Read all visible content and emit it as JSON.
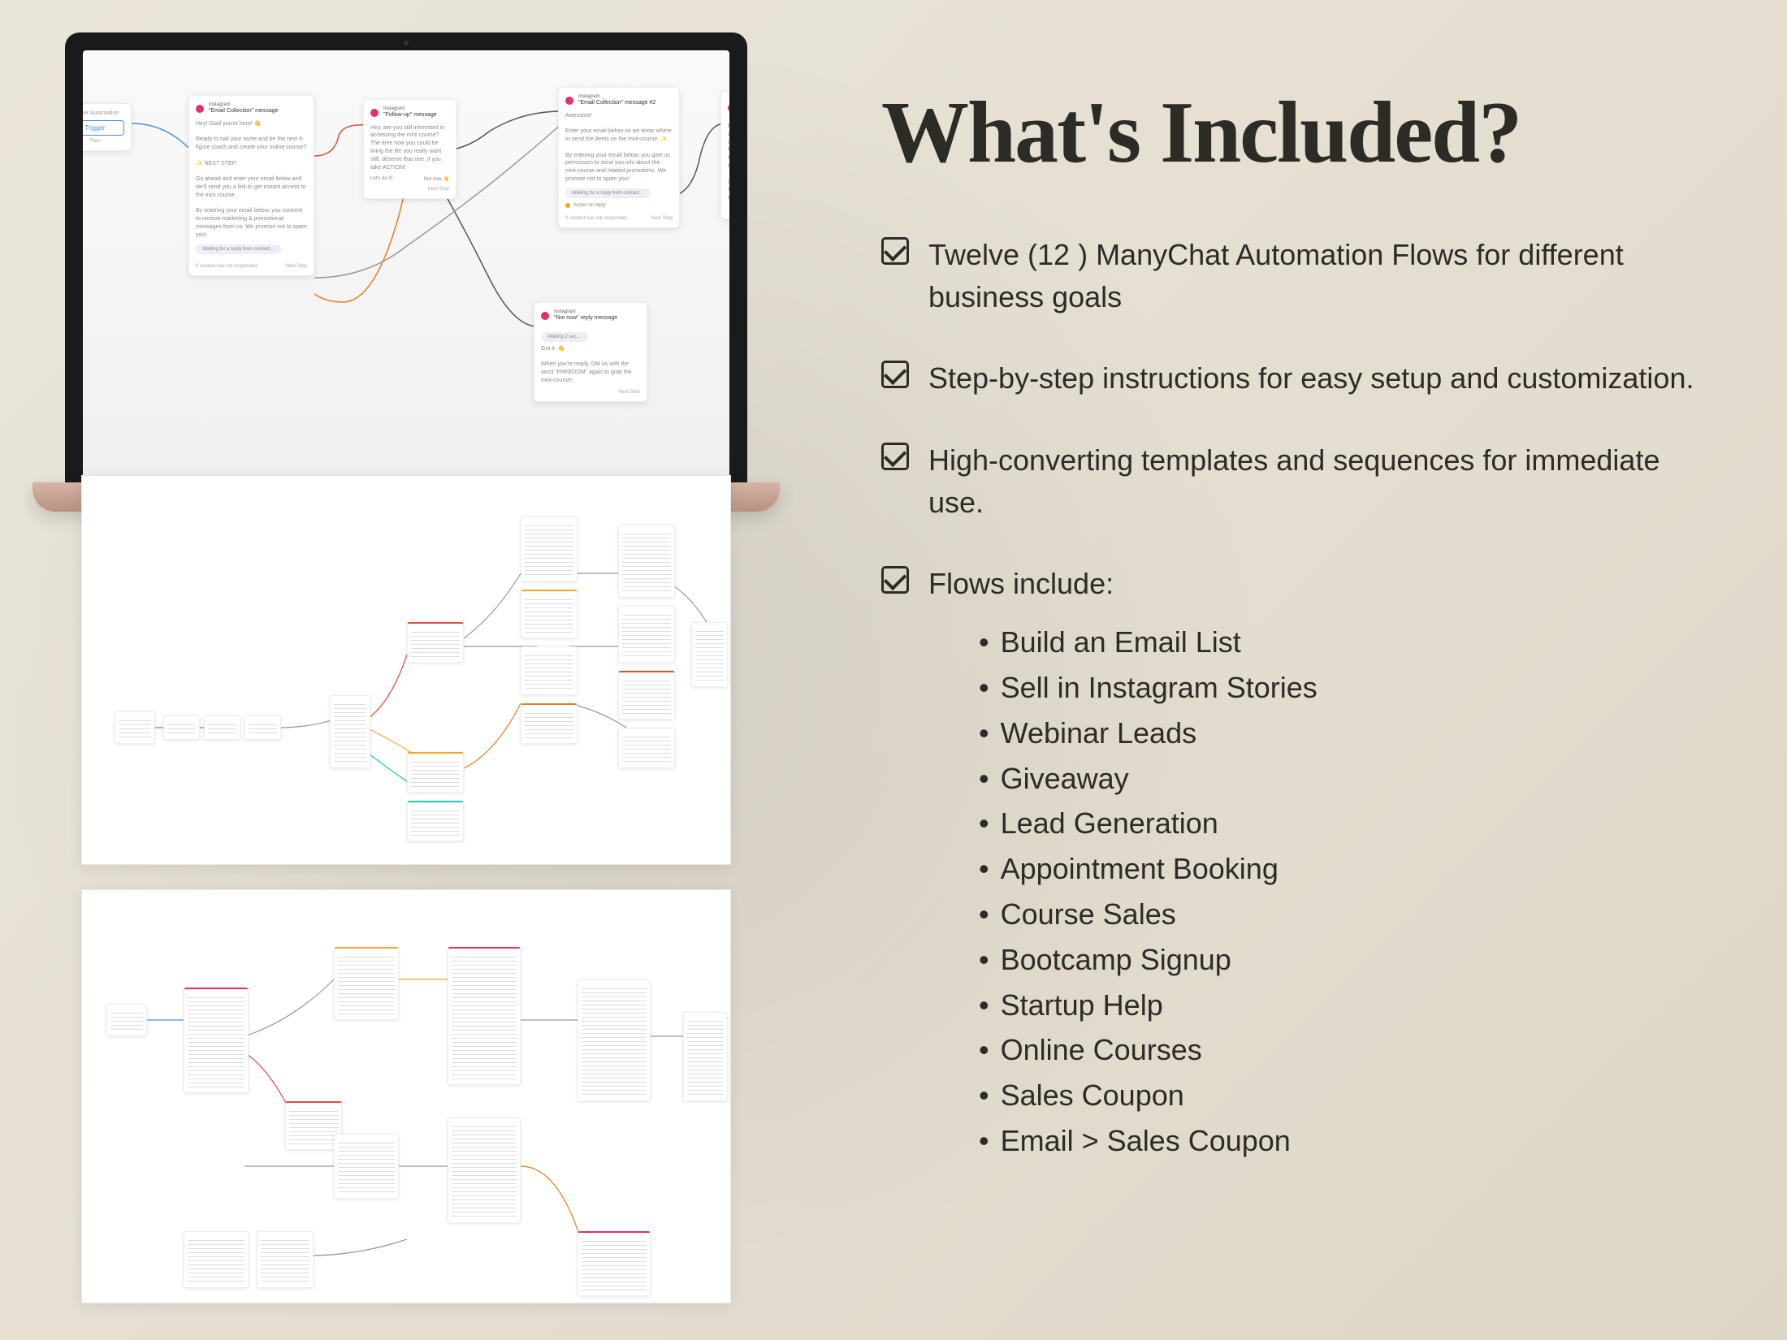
{
  "heading": "What's Included?",
  "features": [
    {
      "text": "Twelve (12 ) ManyChat Automation Flows for different business goals"
    },
    {
      "text": "Step-by-step instructions for easy setup and customization."
    },
    {
      "text": "High-converting templates and sequences for immediate use."
    },
    {
      "text": "Flows include:"
    }
  ],
  "flows": [
    "Build an Email List",
    "Sell in Instagram Stories",
    "Webinar Leads",
    "Giveaway",
    "Lead Generation",
    "Appointment Booking",
    "Course Sales",
    "Bootcamp Signup",
    "Startup Help",
    "Online Courses",
    "Sales Coupon",
    "Email > Sales Coupon"
  ],
  "laptop_nodes": {
    "trigger": {
      "label": "Trigger",
      "subtitle": "new user Automation"
    },
    "n1": {
      "tag": "Instagram",
      "title": "\"Email Collection\" message",
      "body": "Hey! Glad you're here! 👋\n\nReady to nail your niche and be the next 6-figure coach and create your online course?\n\n✨ NEXT STEP:\n\nGo ahead and enter your email below and we'll send you a link to get instant access to the mini course.\n\nBy entering your email below, you consent to receive marketing & promotional messages from us. We promise not to spam you!",
      "chip": "Waiting for a reply from contact…",
      "footer_left": "If contact has not responded",
      "footer_right": "Next Step"
    },
    "n2": {
      "tag": "Instagram",
      "title": "\"Follow-up\" message",
      "body": "Hey, are you still interested in accessing the mini course? The time now you could be living the life you really want still; deserve that one, if you take ACTION!",
      "left": "Let's do it!",
      "right": "Not now 👋",
      "footer": "Next Step"
    },
    "n3": {
      "tag": "Instagram",
      "title": "\"Email Collection\" message #2",
      "body": "Awesome!\n\nEnter your email below so we know where to send the deets on the mini-course. ✨\n\nBy entering your email below, you give us permission to send you info about the mini-course and related promotions. We promise not to spam you!",
      "chip": "Waiting for a reply from contact…",
      "action": "Action on reply",
      "footer_left": "If contact has not responded",
      "footer_right": "Next Step"
    },
    "n4": {
      "tag": "Instagram",
      "title": "\"Not now\" reply message",
      "body": "Got it. 👋\n\nWhen you're ready, DM us with the word \"FREEDOM\" again to grab the mini-course!",
      "chip": "Waiting 2 sec…",
      "footer": "Next Step"
    },
    "n5": {
      "tag": "Instagram",
      "title": "\"Email confirm…",
      "body": "Perfect! You can al… over for a notice f… bonus for the most… the button below t…\n\nI can't wait to see… in courses lead…",
      "footer": "Min-c…"
    }
  }
}
